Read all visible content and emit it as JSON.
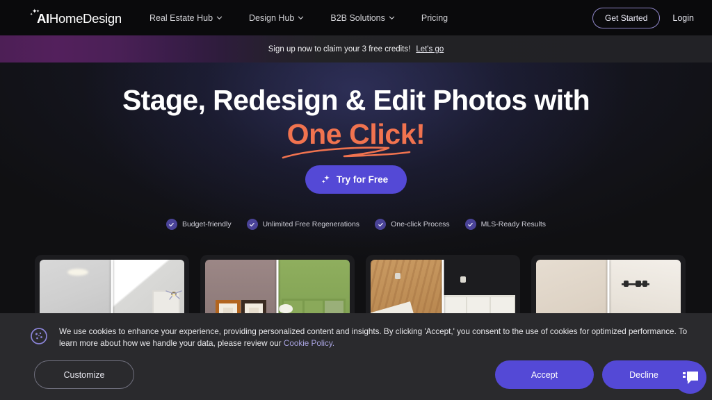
{
  "navbar": {
    "logo": {
      "name": "AI",
      "suffix": "HomeDesign",
      "star_icon": "sparkle-icon"
    },
    "links": [
      {
        "label": "Real Estate Hub",
        "has_caret": true
      },
      {
        "label": "Design Hub",
        "has_caret": true
      },
      {
        "label": "B2B Solutions",
        "has_caret": true
      },
      {
        "label": "Pricing",
        "has_caret": false
      }
    ],
    "get_started": "Get Started",
    "login": "Login"
  },
  "promo": {
    "text": "Sign up now to claim your 3 free credits!",
    "link": "Let's go"
  },
  "hero": {
    "headline": "Stage, Redesign & Edit Photos with",
    "headline_accent": "One Click!",
    "cta": "Try for Free",
    "features": [
      {
        "label": "Budget-friendly"
      },
      {
        "label": "Unlimited Free Regenerations"
      },
      {
        "label": "One-click Process"
      },
      {
        "label": "MLS-Ready Results"
      }
    ]
  },
  "cookie": {
    "text_part1": "We use cookies to enhance your experience, providing personalized content and insights. By clicking 'Accept,' you consent to the use of cookies for optimized performance. To learn more about how we handle your data, please review our ",
    "policy_link": "Cookie Policy.",
    "customize": "Customize",
    "accept": "Accept",
    "decline": "Decline"
  },
  "colors": {
    "accent_purple": "#5449d6",
    "accent_orange": "#f1734f",
    "banner_purple": "#4d1f56",
    "link_lavender": "#a8a3e0",
    "nav_bg": "#0a0a0c",
    "cookie_bg": "#2a2a2d"
  }
}
